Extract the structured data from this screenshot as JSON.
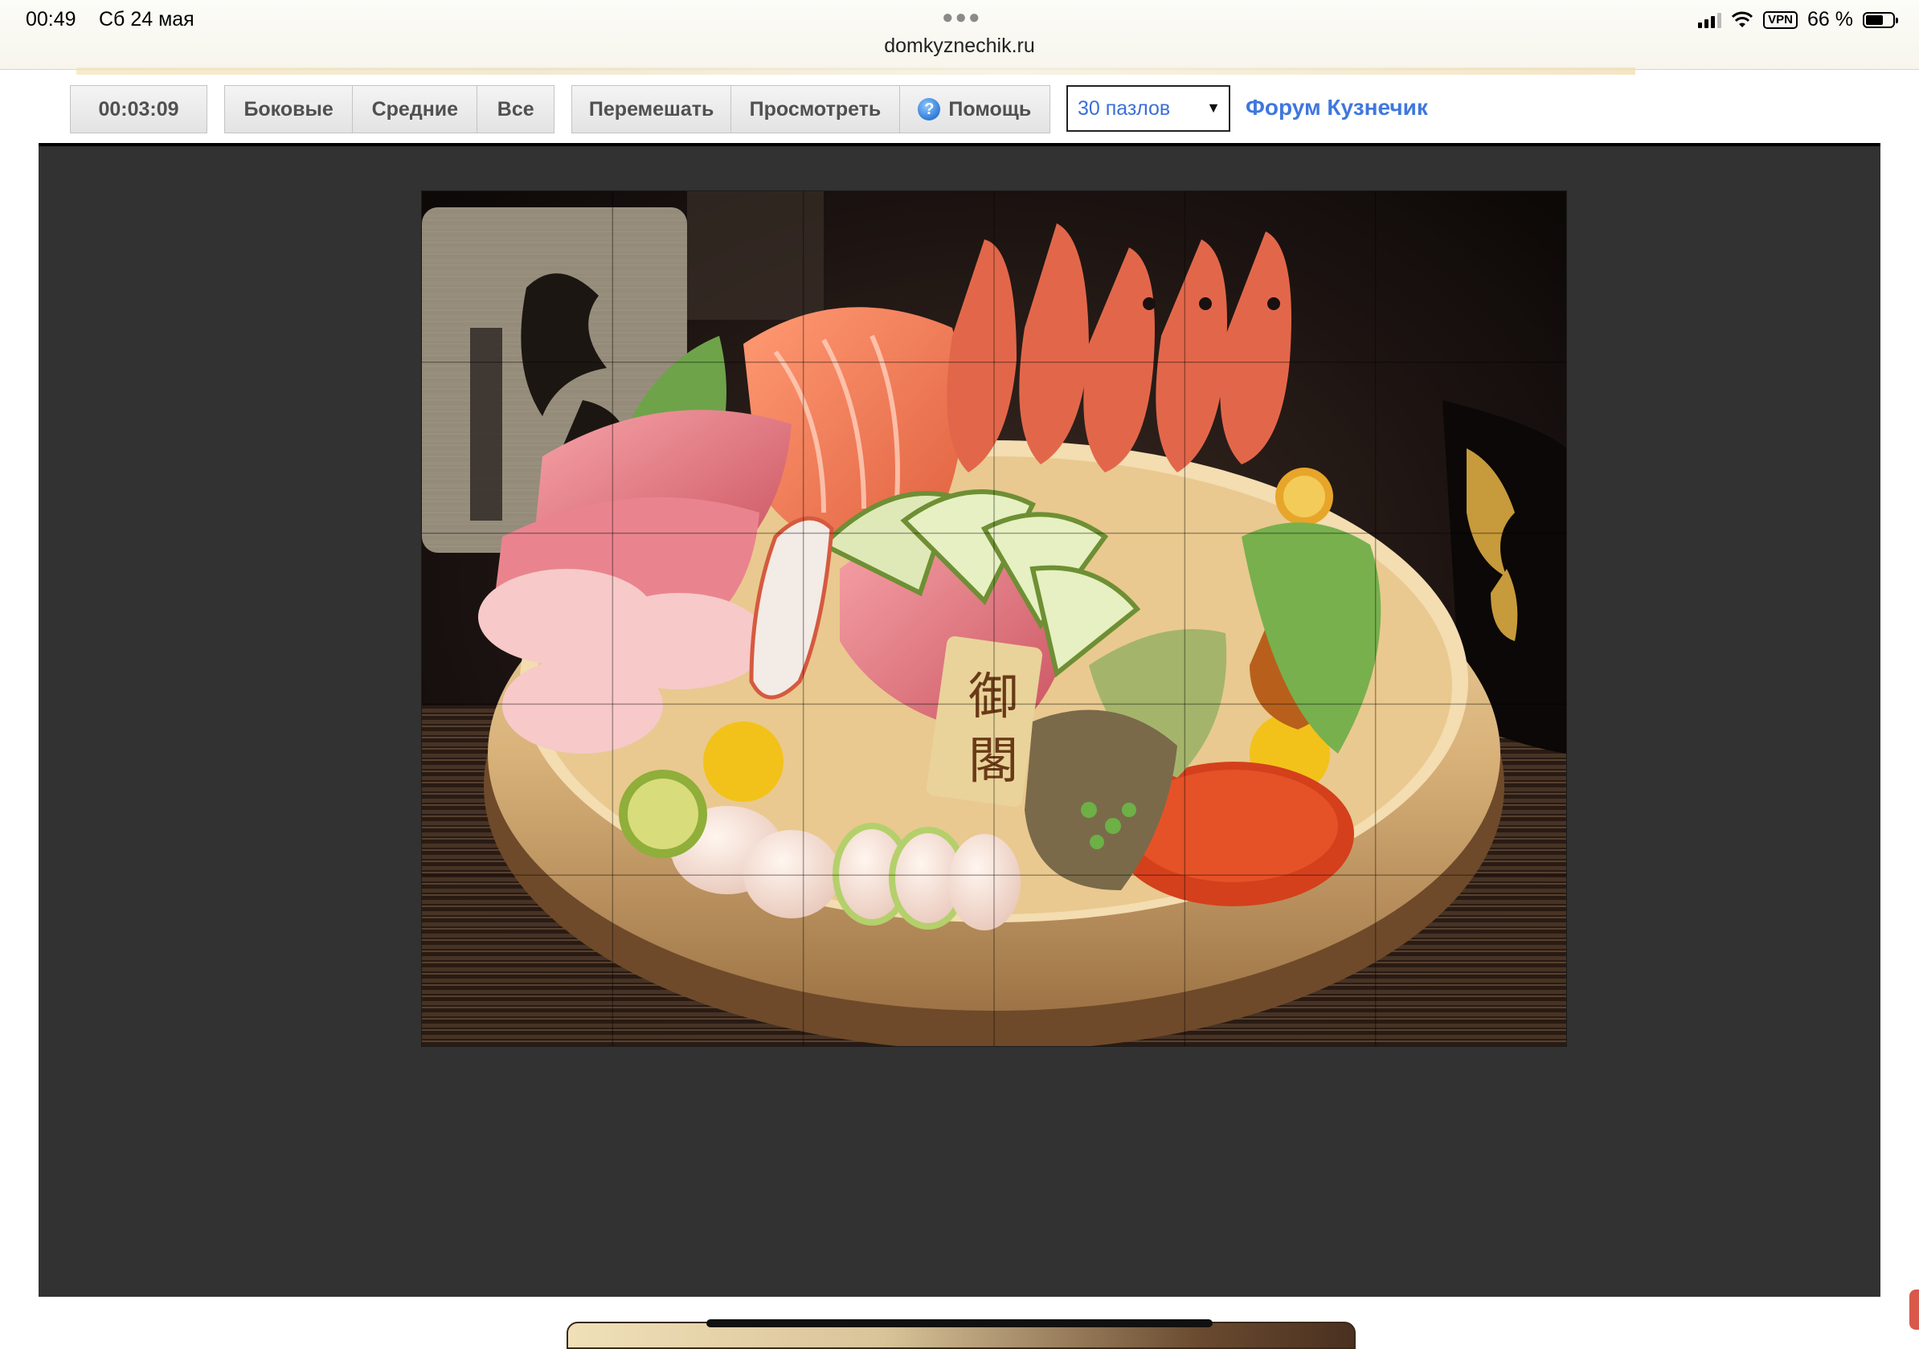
{
  "status_bar": {
    "time": "00:49",
    "date": "Сб 24 мая",
    "url": "domkyznechik.ru",
    "vpn": "VPN",
    "battery": "66 %",
    "battery_level": 0.66
  },
  "toolbar": {
    "timer": "00:03:09",
    "filter_buttons": [
      "Боковые",
      "Средние",
      "Все"
    ],
    "shuffle_label": "Перемешать",
    "preview_label": "Просмотреть",
    "help_label": "Помощь",
    "pieces_select": {
      "selected": "30 пазлов"
    },
    "forum_link": "Форум Кузнечик"
  },
  "puzzle": {
    "pieces": 30,
    "columns": 6,
    "rows": 5,
    "image": "sashimi-bowl",
    "calligraphy": "御閣"
  },
  "colors": {
    "board_bg": "#323232",
    "link": "#3f77dd",
    "select_text": "#3b6fd6"
  }
}
